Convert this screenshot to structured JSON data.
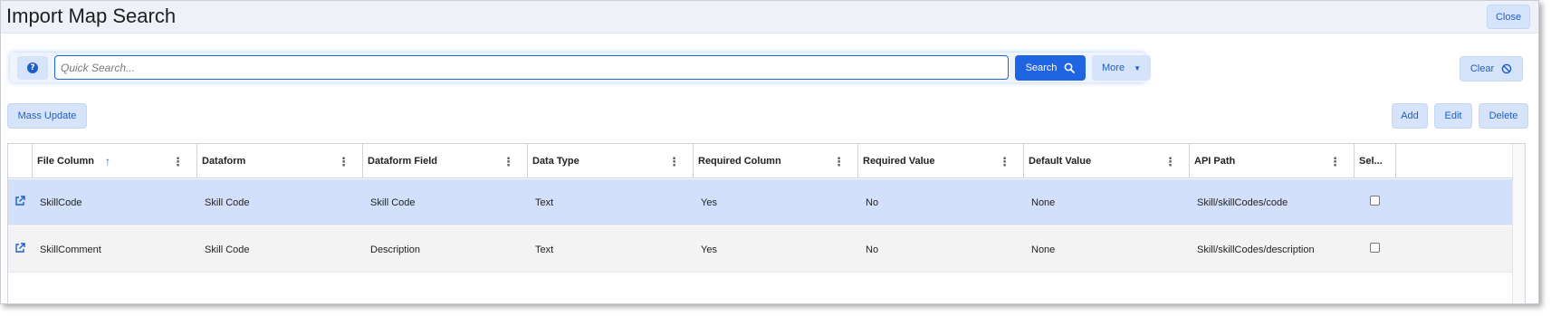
{
  "window": {
    "title": "Import Map Search",
    "close_label": "Close"
  },
  "search": {
    "help_icon": "question-circle-icon",
    "placeholder": "Quick Search...",
    "value": "",
    "search_label": "Search",
    "more_label": "More",
    "clear_label": "Clear"
  },
  "toolbar": {
    "mass_update_label": "Mass Update",
    "add_label": "Add",
    "edit_label": "Edit",
    "delete_label": "Delete"
  },
  "grid": {
    "columns": [
      {
        "label": "File Column",
        "sorted": "ascending"
      },
      {
        "label": "Dataform"
      },
      {
        "label": "Dataform Field"
      },
      {
        "label": "Data Type"
      },
      {
        "label": "Required Column"
      },
      {
        "label": "Required Value"
      },
      {
        "label": "Default Value"
      },
      {
        "label": "API Path"
      },
      {
        "label": "Sel..."
      }
    ],
    "rows": [
      {
        "file_column": "SkillCode",
        "dataform": "Skill Code",
        "dataform_field": "Skill Code",
        "data_type": "Text",
        "required_column": "Yes",
        "required_value": "No",
        "default_value": "None",
        "api_path": "Skill/skillCodes/code",
        "selected": false,
        "highlighted": true
      },
      {
        "file_column": "SkillComment",
        "dataform": "Skill Code",
        "dataform_field": "Description",
        "data_type": "Text",
        "required_column": "Yes",
        "required_value": "No",
        "default_value": "None",
        "api_path": "Skill/skillCodes/description",
        "selected": false,
        "highlighted": false
      }
    ]
  },
  "colors": {
    "accent": "#1f64e0",
    "button_bg": "#d6e4fb",
    "button_text": "#1d5fc7",
    "selected_row": "#d2e0fb",
    "alt_row": "#f3f3f3"
  }
}
